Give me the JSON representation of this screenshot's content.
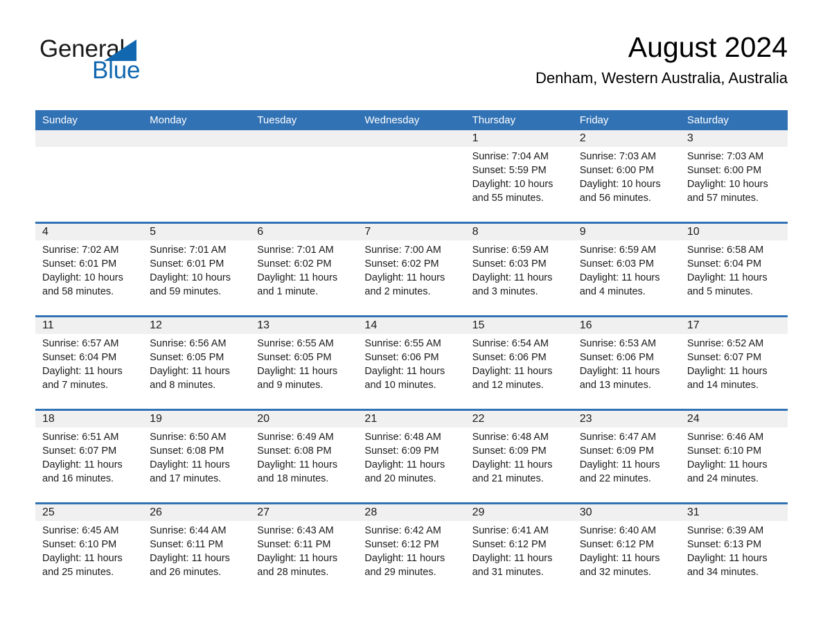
{
  "logo": {
    "word_one": "General",
    "word_two": "Blue",
    "triangle_color": "#1168b0",
    "text_color": "#1a1a1a"
  },
  "header": {
    "month_title": "August 2024",
    "location": "Denham, Western Australia, Australia"
  },
  "theme": {
    "header_blue": "#3172b5",
    "day_band_gray": "#f0f0f0",
    "page_background": "#ffffff",
    "text_color": "#1a1a1a"
  },
  "weekdays": [
    "Sunday",
    "Monday",
    "Tuesday",
    "Wednesday",
    "Thursday",
    "Friday",
    "Saturday"
  ],
  "weeks": [
    [
      {
        "day": "",
        "empty": true
      },
      {
        "day": "",
        "empty": true
      },
      {
        "day": "",
        "empty": true
      },
      {
        "day": "",
        "empty": true
      },
      {
        "day": "1",
        "sunrise": "Sunrise: 7:04 AM",
        "sunset": "Sunset: 5:59 PM",
        "daylight_line1": "Daylight: 10 hours",
        "daylight_line2": "and 55 minutes."
      },
      {
        "day": "2",
        "sunrise": "Sunrise: 7:03 AM",
        "sunset": "Sunset: 6:00 PM",
        "daylight_line1": "Daylight: 10 hours",
        "daylight_line2": "and 56 minutes."
      },
      {
        "day": "3",
        "sunrise": "Sunrise: 7:03 AM",
        "sunset": "Sunset: 6:00 PM",
        "daylight_line1": "Daylight: 10 hours",
        "daylight_line2": "and 57 minutes."
      }
    ],
    [
      {
        "day": "4",
        "sunrise": "Sunrise: 7:02 AM",
        "sunset": "Sunset: 6:01 PM",
        "daylight_line1": "Daylight: 10 hours",
        "daylight_line2": "and 58 minutes."
      },
      {
        "day": "5",
        "sunrise": "Sunrise: 7:01 AM",
        "sunset": "Sunset: 6:01 PM",
        "daylight_line1": "Daylight: 10 hours",
        "daylight_line2": "and 59 minutes."
      },
      {
        "day": "6",
        "sunrise": "Sunrise: 7:01 AM",
        "sunset": "Sunset: 6:02 PM",
        "daylight_line1": "Daylight: 11 hours",
        "daylight_line2": "and 1 minute."
      },
      {
        "day": "7",
        "sunrise": "Sunrise: 7:00 AM",
        "sunset": "Sunset: 6:02 PM",
        "daylight_line1": "Daylight: 11 hours",
        "daylight_line2": "and 2 minutes."
      },
      {
        "day": "8",
        "sunrise": "Sunrise: 6:59 AM",
        "sunset": "Sunset: 6:03 PM",
        "daylight_line1": "Daylight: 11 hours",
        "daylight_line2": "and 3 minutes."
      },
      {
        "day": "9",
        "sunrise": "Sunrise: 6:59 AM",
        "sunset": "Sunset: 6:03 PM",
        "daylight_line1": "Daylight: 11 hours",
        "daylight_line2": "and 4 minutes."
      },
      {
        "day": "10",
        "sunrise": "Sunrise: 6:58 AM",
        "sunset": "Sunset: 6:04 PM",
        "daylight_line1": "Daylight: 11 hours",
        "daylight_line2": "and 5 minutes."
      }
    ],
    [
      {
        "day": "11",
        "sunrise": "Sunrise: 6:57 AM",
        "sunset": "Sunset: 6:04 PM",
        "daylight_line1": "Daylight: 11 hours",
        "daylight_line2": "and 7 minutes."
      },
      {
        "day": "12",
        "sunrise": "Sunrise: 6:56 AM",
        "sunset": "Sunset: 6:05 PM",
        "daylight_line1": "Daylight: 11 hours",
        "daylight_line2": "and 8 minutes."
      },
      {
        "day": "13",
        "sunrise": "Sunrise: 6:55 AM",
        "sunset": "Sunset: 6:05 PM",
        "daylight_line1": "Daylight: 11 hours",
        "daylight_line2": "and 9 minutes."
      },
      {
        "day": "14",
        "sunrise": "Sunrise: 6:55 AM",
        "sunset": "Sunset: 6:06 PM",
        "daylight_line1": "Daylight: 11 hours",
        "daylight_line2": "and 10 minutes."
      },
      {
        "day": "15",
        "sunrise": "Sunrise: 6:54 AM",
        "sunset": "Sunset: 6:06 PM",
        "daylight_line1": "Daylight: 11 hours",
        "daylight_line2": "and 12 minutes."
      },
      {
        "day": "16",
        "sunrise": "Sunrise: 6:53 AM",
        "sunset": "Sunset: 6:06 PM",
        "daylight_line1": "Daylight: 11 hours",
        "daylight_line2": "and 13 minutes."
      },
      {
        "day": "17",
        "sunrise": "Sunrise: 6:52 AM",
        "sunset": "Sunset: 6:07 PM",
        "daylight_line1": "Daylight: 11 hours",
        "daylight_line2": "and 14 minutes."
      }
    ],
    [
      {
        "day": "18",
        "sunrise": "Sunrise: 6:51 AM",
        "sunset": "Sunset: 6:07 PM",
        "daylight_line1": "Daylight: 11 hours",
        "daylight_line2": "and 16 minutes."
      },
      {
        "day": "19",
        "sunrise": "Sunrise: 6:50 AM",
        "sunset": "Sunset: 6:08 PM",
        "daylight_line1": "Daylight: 11 hours",
        "daylight_line2": "and 17 minutes."
      },
      {
        "day": "20",
        "sunrise": "Sunrise: 6:49 AM",
        "sunset": "Sunset: 6:08 PM",
        "daylight_line1": "Daylight: 11 hours",
        "daylight_line2": "and 18 minutes."
      },
      {
        "day": "21",
        "sunrise": "Sunrise: 6:48 AM",
        "sunset": "Sunset: 6:09 PM",
        "daylight_line1": "Daylight: 11 hours",
        "daylight_line2": "and 20 minutes."
      },
      {
        "day": "22",
        "sunrise": "Sunrise: 6:48 AM",
        "sunset": "Sunset: 6:09 PM",
        "daylight_line1": "Daylight: 11 hours",
        "daylight_line2": "and 21 minutes."
      },
      {
        "day": "23",
        "sunrise": "Sunrise: 6:47 AM",
        "sunset": "Sunset: 6:09 PM",
        "daylight_line1": "Daylight: 11 hours",
        "daylight_line2": "and 22 minutes."
      },
      {
        "day": "24",
        "sunrise": "Sunrise: 6:46 AM",
        "sunset": "Sunset: 6:10 PM",
        "daylight_line1": "Daylight: 11 hours",
        "daylight_line2": "and 24 minutes."
      }
    ],
    [
      {
        "day": "25",
        "sunrise": "Sunrise: 6:45 AM",
        "sunset": "Sunset: 6:10 PM",
        "daylight_line1": "Daylight: 11 hours",
        "daylight_line2": "and 25 minutes."
      },
      {
        "day": "26",
        "sunrise": "Sunrise: 6:44 AM",
        "sunset": "Sunset: 6:11 PM",
        "daylight_line1": "Daylight: 11 hours",
        "daylight_line2": "and 26 minutes."
      },
      {
        "day": "27",
        "sunrise": "Sunrise: 6:43 AM",
        "sunset": "Sunset: 6:11 PM",
        "daylight_line1": "Daylight: 11 hours",
        "daylight_line2": "and 28 minutes."
      },
      {
        "day": "28",
        "sunrise": "Sunrise: 6:42 AM",
        "sunset": "Sunset: 6:12 PM",
        "daylight_line1": "Daylight: 11 hours",
        "daylight_line2": "and 29 minutes."
      },
      {
        "day": "29",
        "sunrise": "Sunrise: 6:41 AM",
        "sunset": "Sunset: 6:12 PM",
        "daylight_line1": "Daylight: 11 hours",
        "daylight_line2": "and 31 minutes."
      },
      {
        "day": "30",
        "sunrise": "Sunrise: 6:40 AM",
        "sunset": "Sunset: 6:12 PM",
        "daylight_line1": "Daylight: 11 hours",
        "daylight_line2": "and 32 minutes."
      },
      {
        "day": "31",
        "sunrise": "Sunrise: 6:39 AM",
        "sunset": "Sunset: 6:13 PM",
        "daylight_line1": "Daylight: 11 hours",
        "daylight_line2": "and 34 minutes."
      }
    ]
  ]
}
